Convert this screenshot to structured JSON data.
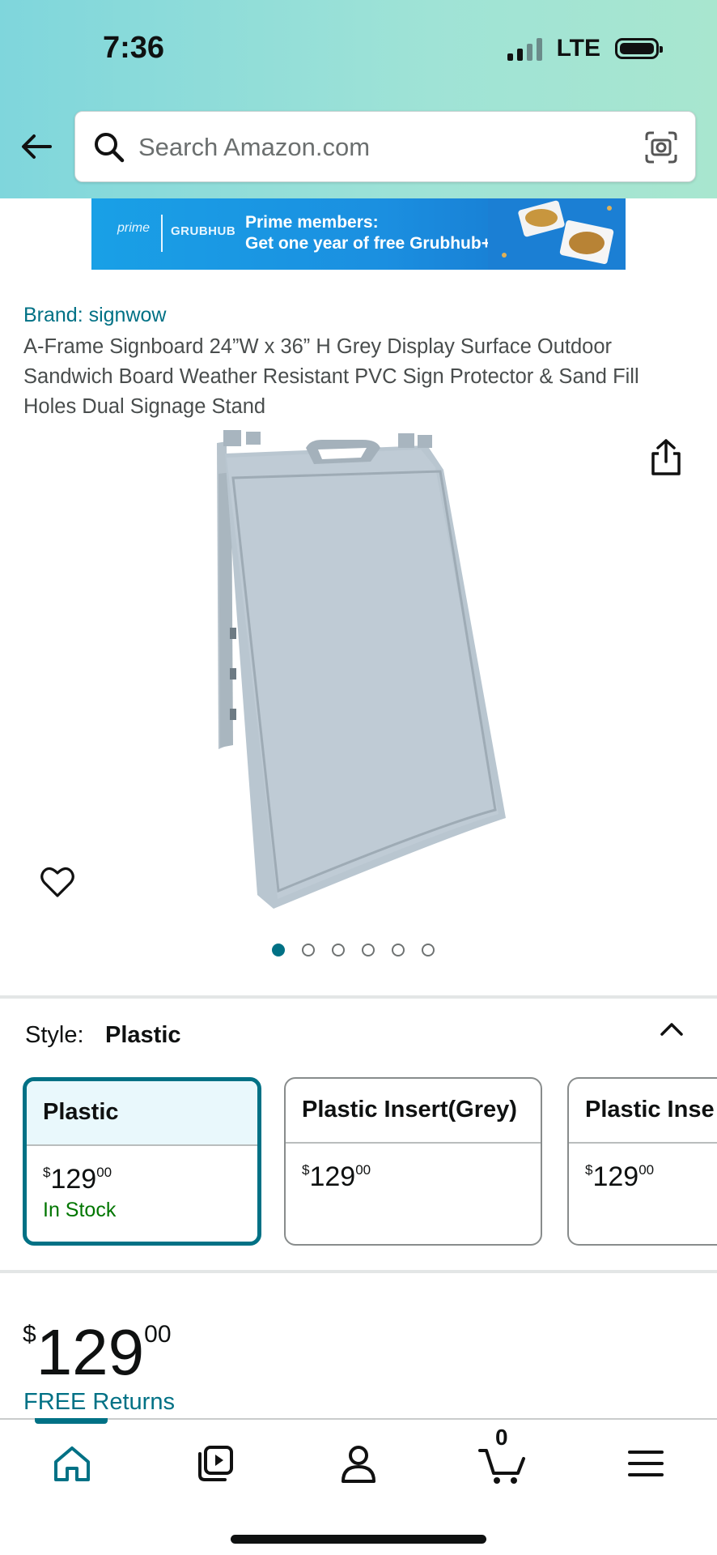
{
  "status_bar": {
    "time": "7:36",
    "network": "LTE"
  },
  "search": {
    "placeholder": "Search Amazon.com"
  },
  "banner": {
    "prime": "prime",
    "partner": "GRUBHUB",
    "line1": "Prime members:",
    "line2": "Get one year of free Grubhub+"
  },
  "product": {
    "brand": "Brand: signwow",
    "title": "A-Frame Signboard 24”W x 36” H Grey Display Surface Outdoor Sandwich Board Weather Resistant PVC Sign Protector & Sand Fill Holes Dual Signage Stand",
    "image_count": 6,
    "active_image": 1
  },
  "style": {
    "label": "Style:",
    "value": "Plastic",
    "options": [
      {
        "name": "Plastic",
        "currency": "$",
        "whole": "129",
        "cents": "00",
        "stock": "In Stock",
        "selected": true
      },
      {
        "name": "Plastic Insert(Grey)",
        "currency": "$",
        "whole": "129",
        "cents": "00",
        "stock": "",
        "selected": false
      },
      {
        "name": "Plastic Inse",
        "currency": "$",
        "whole": "129",
        "cents": "00",
        "stock": "",
        "selected": false
      }
    ]
  },
  "price": {
    "currency": "$",
    "whole": "129",
    "cents": "00"
  },
  "returns": "FREE Returns",
  "nav": {
    "items": [
      "home-icon",
      "video-icon",
      "account-icon",
      "cart-icon",
      "menu-icon"
    ],
    "cart_count": "0",
    "active": "home"
  },
  "colors": {
    "accent": "#007185",
    "in_stock": "#007600",
    "header_start": "#7fd6dc",
    "header_end": "#a8e6cf"
  }
}
